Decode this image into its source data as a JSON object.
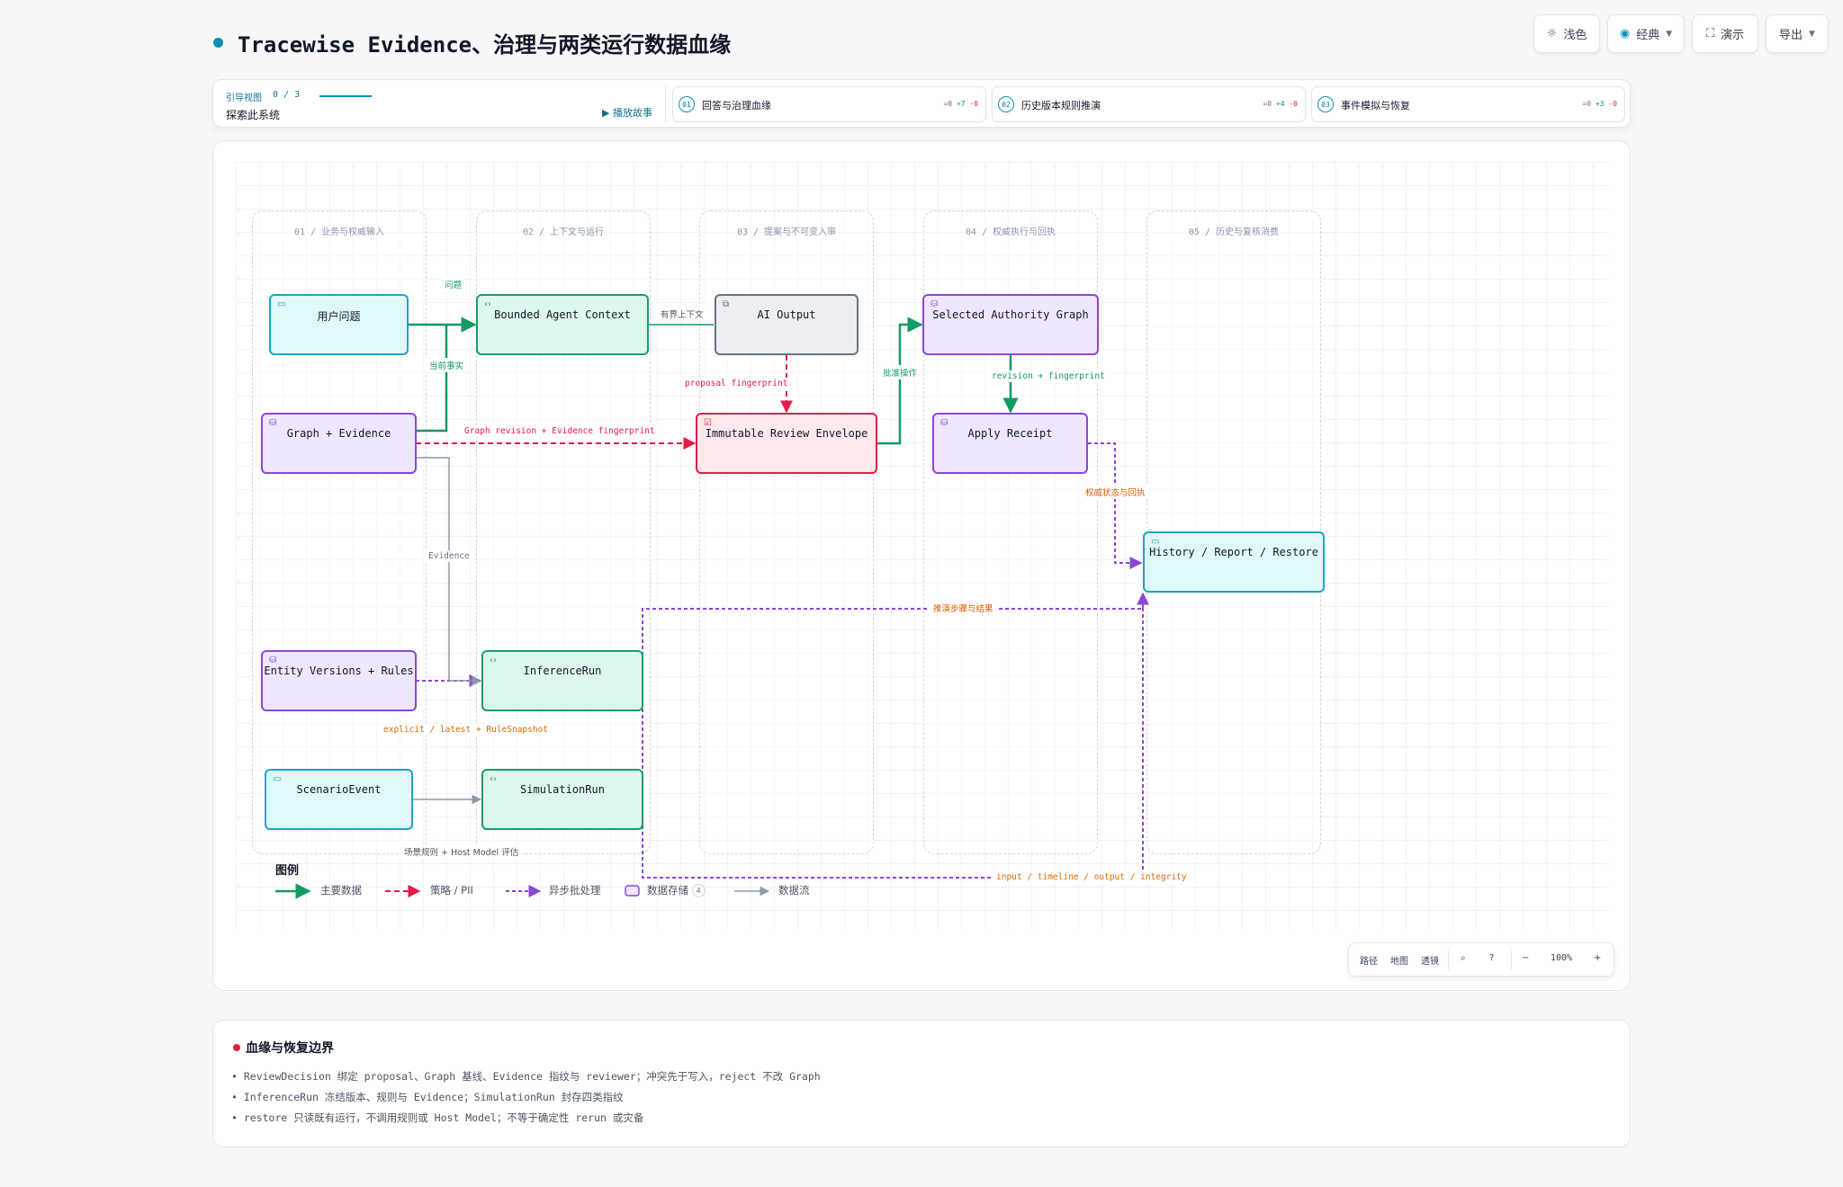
{
  "header": {
    "title": "Tracewise Evidence、治理与两类运行数据血缘",
    "buttons": {
      "theme": "浅色",
      "style": "经典",
      "present": "演示",
      "export": "导出"
    }
  },
  "tour": {
    "label": "引导视图",
    "count": "0 / 3",
    "subtitle": "探索此系统",
    "play": "播放故事",
    "stories": [
      {
        "num": "01",
        "name": "回答与治理血缘",
        "delta_eq": "=0",
        "delta_add": "+7",
        "delta_rem": "-0"
      },
      {
        "num": "02",
        "name": "历史版本规则推演",
        "delta_eq": "=0",
        "delta_add": "+4",
        "delta_rem": "-0"
      },
      {
        "num": "03",
        "name": "事件模拟与恢复",
        "delta_eq": "=0",
        "delta_add": "+3",
        "delta_rem": "-0"
      }
    ]
  },
  "lanes": [
    "01 / 业务与权威输入",
    "02 / 上下文与运行",
    "03 / 提案与不可变入审",
    "04 / 权威执行与回执",
    "05 / 历史与复核消费"
  ],
  "nodes": {
    "user_question": "用户问题",
    "bounded_context": "Bounded Agent Context",
    "ai_output": "AI Output",
    "selected_graph": "Selected Authority Graph",
    "graph_evidence": "Graph + Evidence",
    "review_envelope": "Immutable Review Envelope",
    "apply_receipt": "Apply Receipt",
    "history_report": "History / Report / Restore",
    "entity_versions": "Entity Versions + Rules",
    "inference_run": "InferenceRun",
    "scenario_event": "ScenarioEvent",
    "simulation_run": "SimulationRun"
  },
  "edges": {
    "question": "问题",
    "current_facts": "当前事实",
    "bounded_ctx": "有界上下文",
    "proposal_fp": "proposal fingerprint",
    "approve_op": "批准操作",
    "revision_fp": "revision + fingerprint",
    "graph_rev": "Graph revision + Evidence fingerprint",
    "authority_state": "权威状态与回执",
    "evidence": "Evidence",
    "steps_result": "推演步骤与结果",
    "explicit_latest": "explicit / latest + RuleSnapshot",
    "scenario_rules": "场景规则 + Host Model 评估",
    "io_timeline": "input / timeline / output / integrity"
  },
  "legend": {
    "title": "图例",
    "main_data": "主要数据",
    "policy": "策略 / PII",
    "async": "异步批处理",
    "storage": "数据存储",
    "storage_count": "4",
    "flow": "数据流"
  },
  "zoom": {
    "path": "路径",
    "map": "地图",
    "lens": "透镜",
    "search_icon": "search",
    "help_icon": "help",
    "minus": "−",
    "level": "100%",
    "plus": "+"
  },
  "footer": {
    "title": "血缘与恢复边界",
    "items": [
      "ReviewDecision 绑定 proposal、Graph 基线、Evidence 指纹与 reviewer；冲突先于写入，reject 不改 Graph",
      "InferenceRun 冻结版本、规则与 Evidence；SimulationRun 封存四类指纹",
      "restore 只读既有运行，不调用规则或 Host Model；不等于确定性 rerun 或灾备"
    ]
  },
  "colors": {
    "main": "#159a63",
    "policy": "#e11d48",
    "async": "#8b46d8",
    "flow": "#8d99a8",
    "accent": "#0e8fb0"
  }
}
